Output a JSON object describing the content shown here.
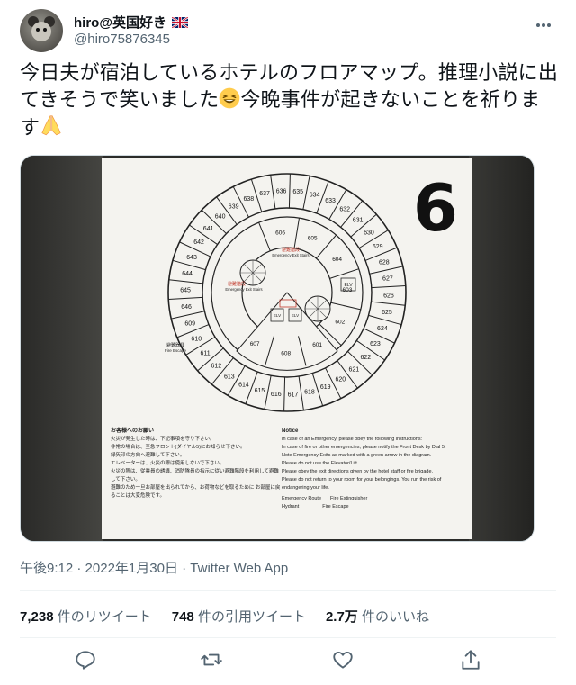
{
  "user": {
    "display_name": "hiro@英国好き",
    "handle": "@hiro75876345",
    "flag_icon": "uk-flag-icon"
  },
  "tweet": {
    "text_part1": "今日夫が宿泊しているホテルのフロアマップ。推理小説に出てきそうで笑いました",
    "emoji1": "laughing-face-icon",
    "text_part2": "今晩事件が起きないことを祈ります",
    "emoji2": "folded-hands-icon"
  },
  "floor_map": {
    "floor_number": "6",
    "outer_rooms": [
      "636",
      "635",
      "634",
      "633",
      "632",
      "631",
      "630",
      "629",
      "628",
      "627",
      "626",
      "625",
      "624",
      "623",
      "622",
      "621",
      "620",
      "619",
      "618",
      "617",
      "616",
      "615",
      "614",
      "613",
      "612",
      "611",
      "610",
      "609",
      "646",
      "645",
      "644",
      "643",
      "642",
      "641",
      "640",
      "639",
      "638",
      "637"
    ],
    "inner_rooms": [
      "606",
      "605",
      "604",
      "603",
      "602",
      "601",
      "608",
      "607"
    ],
    "labels": {
      "exit_stairs_jp": "避難階段",
      "exit_stairs_en": "Emergency Exit Stairs",
      "fire_escape_jp": "避難器具",
      "fire_escape_en": "Fire Escape",
      "elv": "ELV"
    },
    "notice_jp_title": "お客様へのお願い",
    "notice_jp_lines": [
      "火災が発生した時は、下記事項を守り下さい。",
      "非常の場合は、至急フロント(ダイヤル5)にお知らせ下さい。",
      "緑矢印の方向へ避難して下さい。",
      "エレベーターは、火災の際は使用しないで下さい。",
      "火災の際は、従業員の誘導、消防隊員の指示に従い避難階段を利用して避難して下さい。",
      "避難のため一旦お部屋を出られてから、お荷物などを取るために お部屋に戻ることは大変危険です。"
    ],
    "notice_en_title": "Notice",
    "notice_en_intro": "In case of an Emergency, please obey the following instructions:",
    "notice_en_lines": [
      "In case of fire or other emergencies, please notify the Front Desk by Dial 5.",
      "Note Emergency Exits as marked with a green arrow in the diagram.",
      "Please do not use the Elevator/Lift.",
      "Please obey the exit directions given by the hotel staff or fire brigade.",
      "Please do not return to your room for your belongings. You run the risk of endangering your life."
    ],
    "legend_en": [
      "Emergency Route",
      "Fire Extinguisher",
      "Hydrant",
      "Fire Escape"
    ]
  },
  "meta": {
    "time": "午後9:12",
    "separator": "·",
    "date": "2022年1月30日",
    "source": "Twitter Web App"
  },
  "stats": {
    "retweets_count": "7,238",
    "retweets_label": "件のリツイート",
    "quotes_count": "748",
    "quotes_label": "件の引用ツイート",
    "likes_count": "2.7万",
    "likes_label": "件のいいね"
  },
  "colors": {
    "text": "#0f1419",
    "secondary": "#536471",
    "divider": "#eff3f4"
  }
}
